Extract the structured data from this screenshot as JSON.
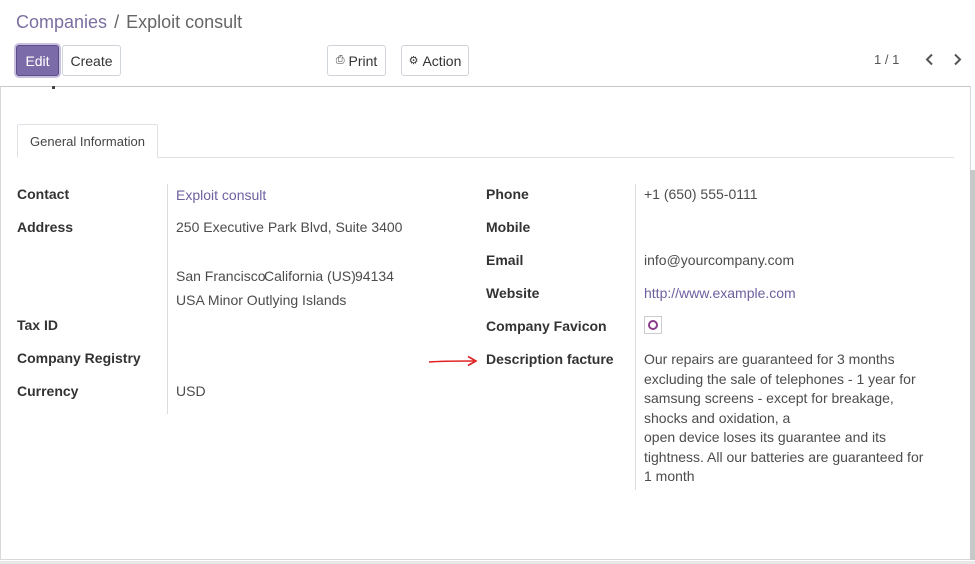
{
  "breadcrumb": {
    "parent": "Companies",
    "separator": "/",
    "current": "Exploit consult"
  },
  "toolbar": {
    "edit_label": "Edit",
    "create_label": "Create",
    "print_label": "Print",
    "action_label": "Action",
    "print_icon": "printer-icon",
    "action_icon": "gear-icon"
  },
  "pager": {
    "value": "1 / 1",
    "prev_icon": "chevron-left-icon",
    "next_icon": "chevron-right-icon"
  },
  "tabs": [
    {
      "label": "General Information"
    }
  ],
  "left_fields": {
    "contact": {
      "label": "Contact",
      "value": "Exploit consult"
    },
    "address": {
      "label": "Address",
      "street": "250 Executive Park Blvd, Suite 3400",
      "city": "San Francisco",
      "state": "California (US)",
      "zip": "94134",
      "country": "USA Minor Outlying Islands"
    },
    "tax_id": {
      "label": "Tax ID",
      "value": ""
    },
    "company_registry": {
      "label": "Company Registry",
      "value": ""
    },
    "currency": {
      "label": "Currency",
      "value": "USD"
    }
  },
  "right_fields": {
    "phone": {
      "label": "Phone",
      "value": "+1 (650) 555-0111"
    },
    "mobile": {
      "label": "Mobile",
      "value": ""
    },
    "email": {
      "label": "Email",
      "value": "info@yourcompany.com"
    },
    "website": {
      "label": "Website",
      "value": "http://www.example.com"
    },
    "favicon": {
      "label": "Company Favicon",
      "icon": "company-favicon-icon"
    },
    "description": {
      "label": "Description facture",
      "value": "Our repairs are guaranteed for 3 months excluding the sale of telephones - 1 year for samsung screens - except for breakage, shocks and oxidation, a\nopen device loses its guarantee and its tightness. All our batteries are guaranteed for 1 month"
    }
  },
  "colors": {
    "primary": "#7c6ba9",
    "link": "#6f5f9e",
    "annotation_arrow": "#e02020"
  }
}
